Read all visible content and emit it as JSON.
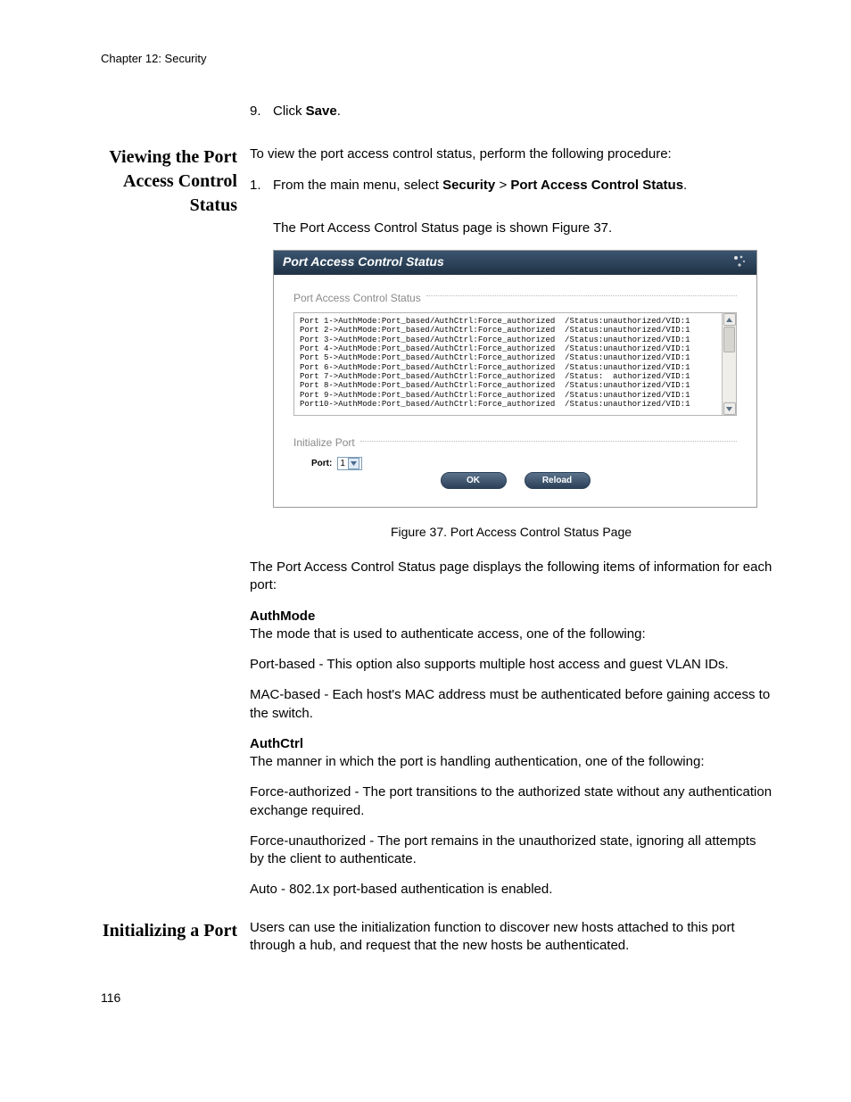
{
  "chapter": "Chapter 12: Security",
  "page_number": "116",
  "step9": {
    "num": "9.",
    "prefix": "Click ",
    "action": "Save",
    "suffix": "."
  },
  "section1": {
    "title": "Viewing the Port Access Control Status",
    "intro": "To view the port access control status, perform the following procedure:",
    "step1": {
      "num": "1.",
      "prefix": "From the main menu, select ",
      "b1": "Security",
      "sep": " > ",
      "b2": "Port Access Control Status",
      "suffix": "."
    },
    "shown": "The Port Access Control Status page is shown Figure 37."
  },
  "panel": {
    "title": "Port Access Control Status",
    "section_label": "Port Access Control Status",
    "status_lines": [
      "Port 1->AuthMode:Port_based/AuthCtrl:Force_authorized  /Status:unauthorized/VID:1",
      "Port 2->AuthMode:Port_based/AuthCtrl:Force_authorized  /Status:unauthorized/VID:1",
      "Port 3->AuthMode:Port_based/AuthCtrl:Force_authorized  /Status:unauthorized/VID:1",
      "Port 4->AuthMode:Port_based/AuthCtrl:Force_authorized  /Status:unauthorized/VID:1",
      "Port 5->AuthMode:Port_based/AuthCtrl:Force_authorized  /Status:unauthorized/VID:1",
      "Port 6->AuthMode:Port_based/AuthCtrl:Force_authorized  /Status:unauthorized/VID:1",
      "Port 7->AuthMode:Port_based/AuthCtrl:Force_authorized  /Status:  authorized/VID:1",
      "Port 8->AuthMode:Port_based/AuthCtrl:Force_authorized  /Status:unauthorized/VID:1",
      "Port 9->AuthMode:Port_based/AuthCtrl:Force_authorized  /Status:unauthorized/VID:1",
      "Port10->AuthMode:Port_based/AuthCtrl:Force_authorized  /Status:unauthorized/VID:1"
    ],
    "init_label": "Initialize Port",
    "port_label": "Port:",
    "port_value": "1",
    "btn_ok": "OK",
    "btn_reload": "Reload"
  },
  "figure_caption": "Figure 37. Port Access Control Status Page",
  "desc": {
    "para1": "The Port Access Control Status page displays the following items of information for each port:",
    "authmode": {
      "title": "AuthMode",
      "line1": "The mode that is used to authenticate access, one of the following:",
      "line2": "Port-based - This option also supports multiple host access and guest VLAN IDs.",
      "line3": "MAC-based - Each host's MAC address must be authenticated before gaining access to the switch."
    },
    "authctrl": {
      "title": "AuthCtrl",
      "line1": "The manner in which the port is handling authentication, one of the following:",
      "line2": "Force-authorized - The port transitions to the authorized state without any authentication exchange required.",
      "line3": "Force-unauthorized - The port remains in the unauthorized state, ignoring all attempts by the client to authenticate.",
      "line4": "Auto - 802.1x port-based authentication is enabled."
    }
  },
  "section2": {
    "title": "Initializing a Port",
    "body": "Users can use the initialization function to discover new hosts attached to this port through a hub, and request that the new hosts be authenticated."
  }
}
